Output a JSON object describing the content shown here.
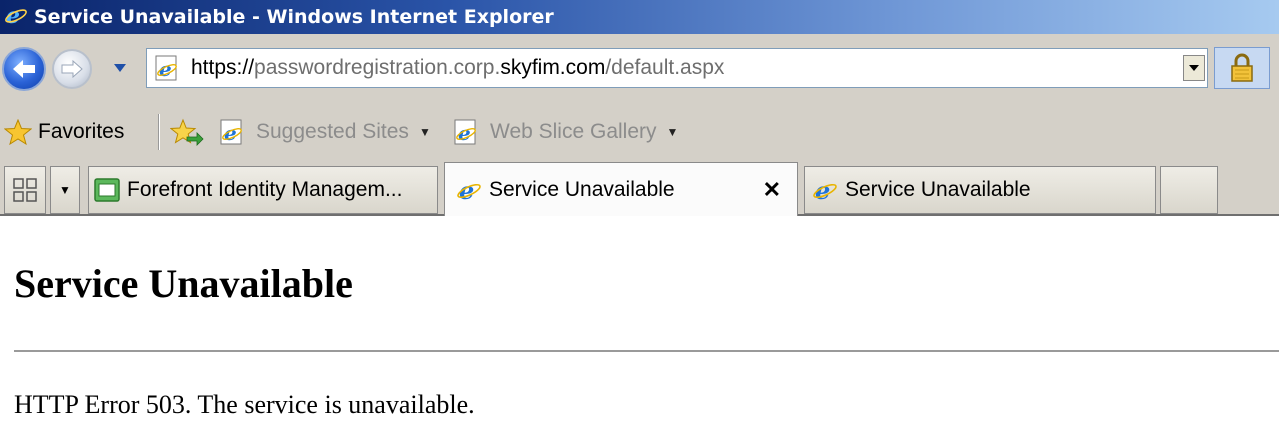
{
  "window": {
    "title": "Service Unavailable - Windows Internet Explorer"
  },
  "address_bar": {
    "url_prefix": "https://",
    "url_subdomain": "passwordregistration.corp.",
    "url_domain": "skyfim.com",
    "url_path": "/default.aspx"
  },
  "favorites_bar": {
    "favorites_label": "Favorites",
    "items": [
      {
        "label": "Suggested Sites"
      },
      {
        "label": "Web Slice Gallery"
      }
    ]
  },
  "tabs": [
    {
      "label": "Forefront Identity Managem...",
      "active": false
    },
    {
      "label": "Service Unavailable",
      "active": true
    },
    {
      "label": "Service Unavailable",
      "active": false
    }
  ],
  "tab_close_glyph": "✕",
  "page": {
    "heading": "Service Unavailable",
    "message": "HTTP Error 503. The service is unavailable."
  },
  "colors": {
    "titlebar_dark": "#0a246a",
    "titlebar_light": "#a6caf0",
    "chrome": "#d4d0c8",
    "ie_blue": "#1e73d8"
  }
}
